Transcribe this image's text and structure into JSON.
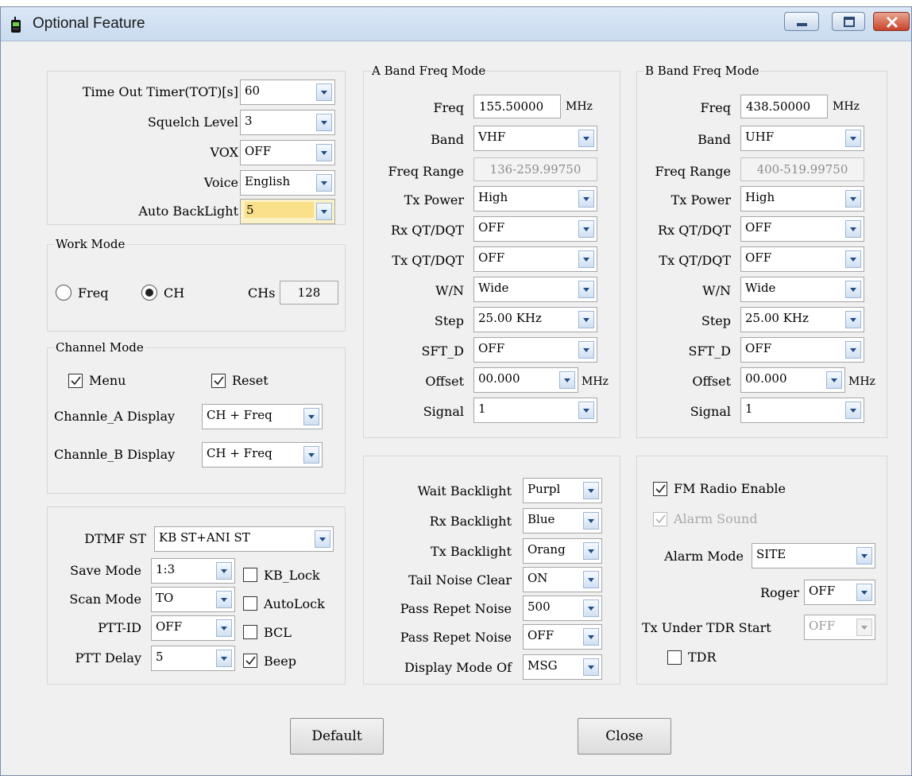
{
  "window": {
    "title": "Optional Feature",
    "icon": "radio-device-icon",
    "controls": [
      "minimize-icon",
      "maximize-icon",
      "close-icon"
    ]
  },
  "general": {
    "tot_label": "Time Out Timer(TOT)[s]",
    "tot_value": "60",
    "squelch_label": "Squelch Level",
    "squelch_value": "3",
    "vox_label": "VOX",
    "vox_value": "OFF",
    "voice_label": "Voice",
    "voice_value": "English",
    "backlight_label": "Auto BackLight",
    "backlight_value": "5"
  },
  "work_mode": {
    "title": "Work Mode",
    "freq_label": "Freq",
    "freq_selected": false,
    "ch_label": "CH",
    "ch_selected": true,
    "chs_label": "CHs",
    "chs_value": "128"
  },
  "channel_mode": {
    "title": "Channel Mode",
    "menu_label": "Menu",
    "menu_checked": true,
    "reset_label": "Reset",
    "reset_checked": true,
    "a_display_label": "Channle_A Display",
    "a_display_value": "CH + Freq",
    "b_display_label": "Channle_B Display",
    "b_display_value": "CH + Freq"
  },
  "dtmf": {
    "dtmf_st_label": "DTMF ST",
    "dtmf_st_value": "KB ST+ANI ST",
    "save_mode_label": "Save Mode",
    "save_mode_value": "1:3",
    "scan_mode_label": "Scan Mode",
    "scan_mode_value": "TO",
    "ptt_id_label": "PTT-ID",
    "ptt_id_value": "OFF",
    "ptt_delay_label": "PTT Delay",
    "ptt_delay_value": "5",
    "kb_lock_label": "KB_Lock",
    "kb_lock_checked": false,
    "autolock_label": "AutoLock",
    "autolock_checked": false,
    "bcl_label": "BCL",
    "bcl_checked": false,
    "beep_label": "Beep",
    "beep_checked": true
  },
  "band_a": {
    "title": "A Band Freq Mode",
    "freq_label": "Freq",
    "freq_value": "155.50000",
    "freq_unit": "MHz",
    "band_label": "Band",
    "band_value": "VHF",
    "range_label": "Freq Range",
    "range_value": "136-259.99750",
    "txpower_label": "Tx Power",
    "txpower_value": "High",
    "rxqt_label": "Rx QT/DQT",
    "rxqt_value": "OFF",
    "txqt_label": "Tx QT/DQT",
    "txqt_value": "OFF",
    "wn_label": "W/N",
    "wn_value": "Wide",
    "step_label": "Step",
    "step_value": "25.00 KHz",
    "sftd_label": "SFT_D",
    "sftd_value": "OFF",
    "offset_label": "Offset",
    "offset_value": "00.000",
    "offset_unit": "MHz",
    "signal_label": "Signal",
    "signal_value": "1"
  },
  "band_b": {
    "title": "B Band Freq Mode",
    "freq_label": "Freq",
    "freq_value": "438.50000",
    "freq_unit": "MHz",
    "band_label": "Band",
    "band_value": "UHF",
    "range_label": "Freq Range",
    "range_value": "400-519.99750",
    "txpower_label": "Tx Power",
    "txpower_value": "High",
    "rxqt_label": "Rx QT/DQT",
    "rxqt_value": "OFF",
    "txqt_label": "Tx QT/DQT",
    "txqt_value": "OFF",
    "wn_label": "W/N",
    "wn_value": "Wide",
    "step_label": "Step",
    "step_value": "25.00 KHz",
    "sftd_label": "SFT_D",
    "sftd_value": "OFF",
    "offset_label": "Offset",
    "offset_value": "00.000",
    "offset_unit": "MHz",
    "signal_label": "Signal",
    "signal_value": "1"
  },
  "backlight": {
    "wait_label": "Wait Backlight",
    "wait_value": "Purpl",
    "rx_label": "Rx Backlight",
    "rx_value": "Blue",
    "tx_label": "Tx Backlight",
    "tx_value": "Orang",
    "tail_label": "Tail Noise Clear",
    "tail_value": "ON",
    "pass1_label": "Pass Repet Noise",
    "pass1_value": "500",
    "pass2_label": "Pass Repet Noise",
    "pass2_value": "OFF",
    "display_label": "Display Mode Of",
    "display_value": "MSG"
  },
  "fm": {
    "fm_label": "FM Radio Enable",
    "fm_checked": true,
    "alarm_sound_label": "Alarm Sound",
    "alarm_sound_checked": true,
    "alarm_mode_label": "Alarm Mode",
    "alarm_mode_value": "SITE",
    "roger_label": "Roger",
    "roger_value": "OFF",
    "tdr_start_label": "Tx Under TDR Start",
    "tdr_start_value": "OFF",
    "tdr_label": "TDR",
    "tdr_checked": false
  },
  "buttons": {
    "default_label": "Default",
    "close_label": "Close"
  },
  "colors": {
    "titlebar": "#c9dbef",
    "highlight": "#fbe08c",
    "close_button": "#c8432b",
    "dropdown_arrow": "#1f4d86"
  }
}
